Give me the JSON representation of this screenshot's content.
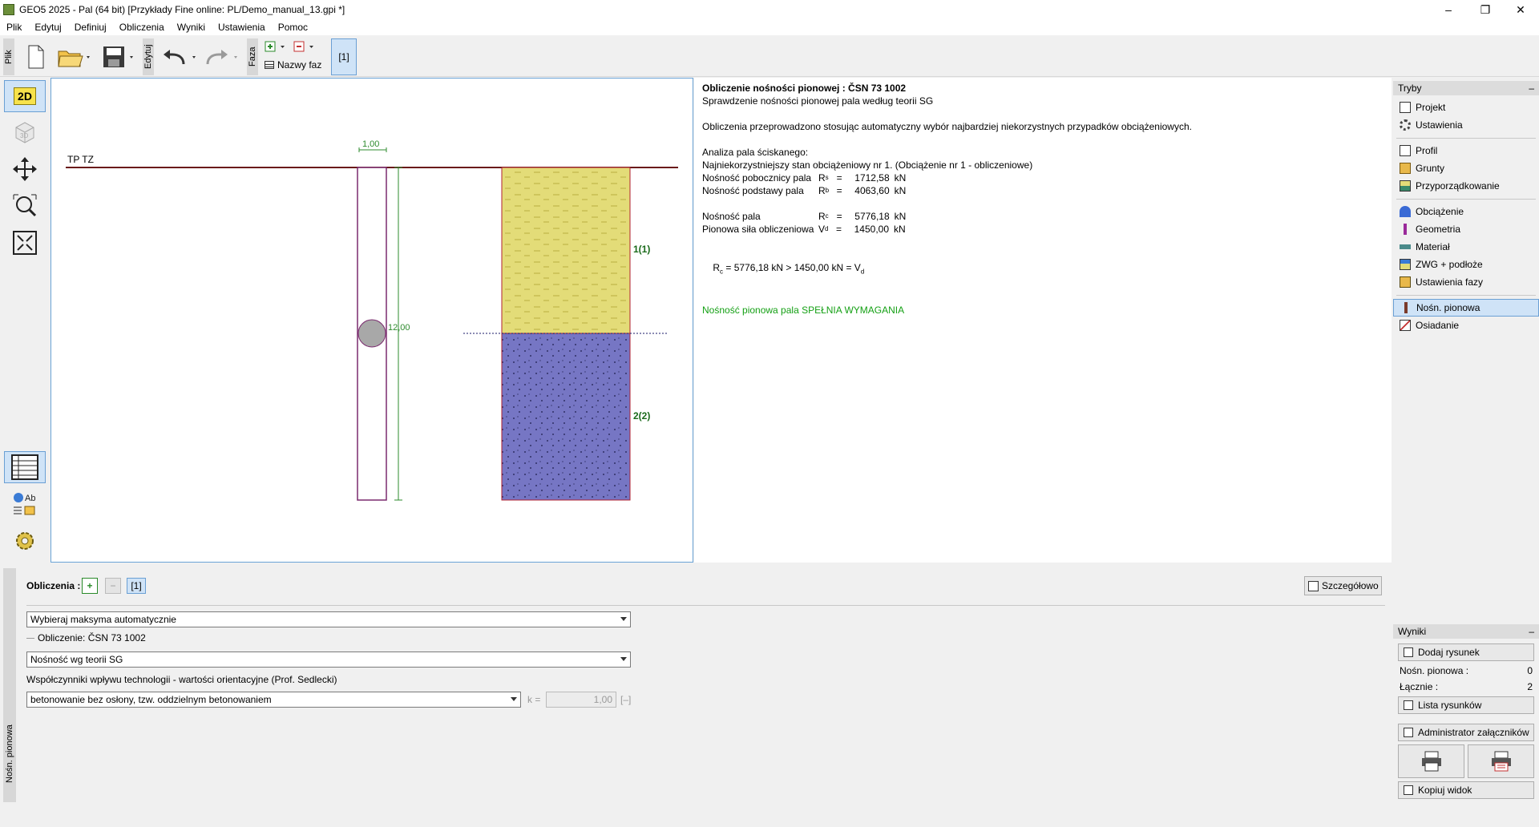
{
  "window": {
    "title": "GEO5 2025 - Pal (64 bit) [Przykłady Fine online: PL/Demo_manual_13.gpi *]",
    "minimize": "–",
    "maximize": "❐",
    "close": "✕"
  },
  "menu": [
    "Plik",
    "Edytuj",
    "Definiuj",
    "Obliczenia",
    "Wyniki",
    "Ustawienia",
    "Pomoc"
  ],
  "toolbar": {
    "file_tab": "Plik",
    "edit_tab": "Edytuj",
    "phase_tab": "Faza",
    "phase_names": "Nazwy faz",
    "phase_badge": "[1]"
  },
  "left_tools": {
    "btn_2d": "2D",
    "btn_3d": "3D"
  },
  "drawing": {
    "terrain_label": "TP TZ",
    "width_dim": "1,00",
    "length_dim": "12,00",
    "layer1": "1(1)",
    "layer2": "2(2)"
  },
  "results": {
    "title": "Obliczenie nośności pionowej : ČSN 73 1002",
    "subtitle": "Sprawdzenie nośności pionowej pala według teorii SG",
    "note": "Obliczenia przeprowadzono stosując automatyczny wybór najbardziej niekorzystnych przypadków obciążeniowych.",
    "analysis_heading": "Analiza pala ściskanego:",
    "worst_case": "Najniekorzystniejszy stan obciążeniowy nr 1. (Obciążenie nr 1 - obliczeniowe)",
    "rows_a": [
      {
        "label": "Nośność pobocznicy pala",
        "sym": "R",
        "sub": "s",
        "eq": "=",
        "value": "1712,58",
        "unit": "kN"
      },
      {
        "label": "Nośność podstawy pala",
        "sym": "R",
        "sub": "b",
        "eq": "=",
        "value": "4063,60",
        "unit": "kN"
      }
    ],
    "rows_b": [
      {
        "label": "Nośność pala",
        "sym": "R",
        "sub": "c",
        "eq": "=",
        "value": "5776,18",
        "unit": "kN"
      },
      {
        "label": "Pionowa siła obliczeniowa",
        "sym": "V",
        "sub": "d",
        "eq": "=",
        "value": "1450,00",
        "unit": "kN"
      }
    ],
    "check_lhs": "R",
    "check_lhs_sub": "c",
    "check_mid": " = 5776,18 kN > 1450,00 kN = V",
    "check_rhs_sub": "d",
    "verdict": "Nośność pionowa pala SPEŁNIA WYMAGANIA"
  },
  "modes": {
    "header": "Tryby",
    "groups": [
      [
        {
          "label": "Projekt",
          "icon": "project-icon"
        },
        {
          "label": "Ustawienia",
          "icon": "gear-icon"
        }
      ],
      [
        {
          "label": "Profil",
          "icon": "profile-icon"
        },
        {
          "label": "Grunty",
          "icon": "soil-icon"
        },
        {
          "label": "Przyporządkowanie",
          "icon": "assign-icon"
        }
      ],
      [
        {
          "label": "Obciążenie",
          "icon": "load-icon"
        },
        {
          "label": "Geometria",
          "icon": "geometry-icon"
        },
        {
          "label": "Materiał",
          "icon": "material-icon"
        },
        {
          "label": "ZWG + podłoże",
          "icon": "water-icon"
        },
        {
          "label": "Ustawienia fazy",
          "icon": "phase-settings-icon"
        }
      ],
      [
        {
          "label": "Nośn. pionowa",
          "icon": "bearing-icon"
        },
        {
          "label": "Osiadanie",
          "icon": "settlement-icon"
        }
      ]
    ]
  },
  "outputs": {
    "header": "Wyniki",
    "add_picture": "Dodaj rysunek",
    "count_label": "Nośn. pionowa :",
    "count_value": "0",
    "total_label": "Łącznie :",
    "total_value": "2",
    "list_pictures": "Lista rysunków",
    "attachments": "Administrator załączników",
    "copy_view": "Kopiuj widok"
  },
  "bottom": {
    "side_tab": "Nośn. pionowa",
    "calc_label": "Obliczenia :",
    "calc_badge": "[1]",
    "detail_button": "Szczegółowo",
    "combo1": "Wybieraj maksyma automatycznie",
    "section_label": "Obliczenie: ČSN 73 1002",
    "combo2": "Nośność wg teorii SG",
    "coeff_label": "Współczynniki wpływu technologii - wartości orientacyjne (Prof. Sedlecki)",
    "combo3": "betonowanie bez osłony, tzw. oddzielnym betonowaniem",
    "k_label": "k =",
    "k_value": "1,00",
    "k_unit": "[–]"
  },
  "colors": {
    "layer1": "#e3dc78",
    "layer2": "#7676c4",
    "pile_outline": "#7a2a6e",
    "ok_green": "#14a014",
    "dim_green": "#2e8b2e",
    "accent_blue": "#6aa3d6"
  }
}
